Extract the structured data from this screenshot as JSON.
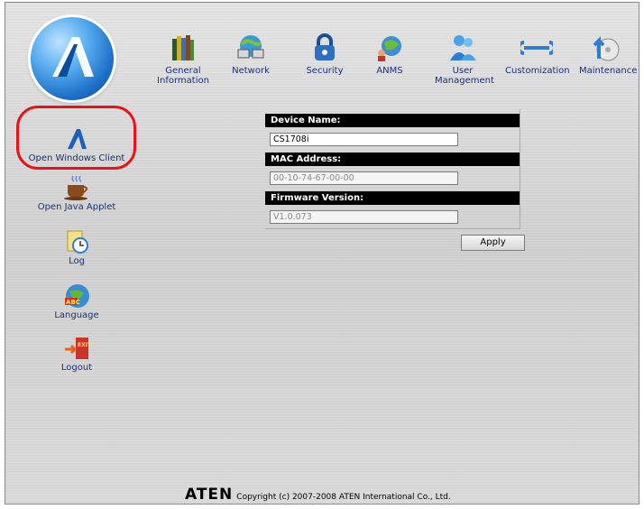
{
  "nav": [
    {
      "key": "general",
      "label_lines": [
        "General",
        "Information"
      ],
      "icon": "books-icon"
    },
    {
      "key": "network",
      "label_lines": [
        "Network"
      ],
      "icon": "network-icon"
    },
    {
      "key": "security",
      "label_lines": [
        "Security"
      ],
      "icon": "lock-icon"
    },
    {
      "key": "anms",
      "label_lines": [
        "ANMS"
      ],
      "icon": "globe-people-icon"
    },
    {
      "key": "user",
      "label_lines": [
        "User",
        "Management"
      ],
      "icon": "users-icon"
    },
    {
      "key": "customization",
      "label_lines": [
        "Customization"
      ],
      "icon": "wrench-icon"
    },
    {
      "key": "maintenance",
      "label_lines": [
        "Maintenance"
      ],
      "icon": "upload-cd-icon"
    }
  ],
  "sidebar": [
    {
      "key": "windows",
      "label": "Open Windows Client",
      "icon": "aten-a-icon",
      "highlighted": true
    },
    {
      "key": "java",
      "label": "Open Java Applet",
      "icon": "coffee-cup-icon"
    },
    {
      "key": "log",
      "label": "Log",
      "icon": "log-clock-icon"
    },
    {
      "key": "language",
      "label": "Language",
      "icon": "abc-globe-icon"
    },
    {
      "key": "logout",
      "label": "Logout",
      "icon": "exit-door-icon"
    }
  ],
  "form": {
    "device_name": {
      "label": "Device Name:",
      "value": "CS1708i"
    },
    "mac_address": {
      "label": "MAC Address:",
      "value": "00-10-74-67-00-00"
    },
    "firmware_version": {
      "label": "Firmware Version:",
      "value": "V1.0.073"
    },
    "apply_label": "Apply"
  },
  "footer": {
    "brand": "ATEN",
    "copyright": "Copyright (c) 2007-2008 ATEN International Co., Ltd."
  },
  "colors": {
    "nav_text": "#1a2f7a",
    "highlight": "#e8131a",
    "header_bg": "#000000"
  }
}
